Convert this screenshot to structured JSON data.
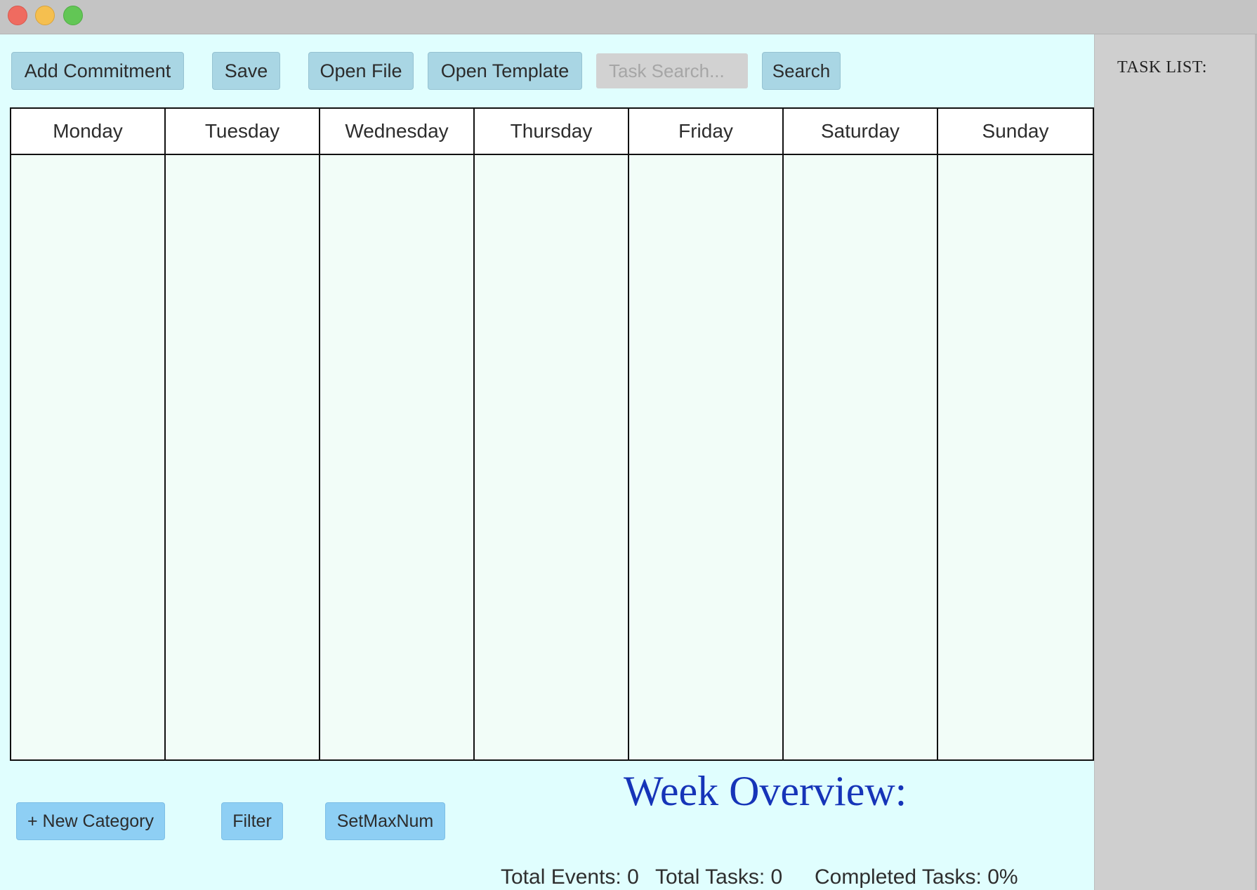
{
  "window": {
    "controls": [
      "close",
      "minimize",
      "maximize"
    ]
  },
  "toolbar": {
    "add_commitment": "Add Commitment",
    "save": "Save",
    "open_file": "Open File",
    "open_template": "Open Template",
    "search_placeholder": "Task Search...",
    "search_value": "",
    "search": "Search"
  },
  "calendar": {
    "days": [
      "Monday",
      "Tuesday",
      "Wednesday",
      "Thursday",
      "Friday",
      "Saturday",
      "Sunday"
    ]
  },
  "bottom": {
    "new_category": "+ New Category",
    "filter": "Filter",
    "set_max_num": "SetMaxNum"
  },
  "overview": {
    "title": "Week Overview:",
    "total_events": "Total Events: 0",
    "total_tasks": "Total Tasks: 0",
    "completed_tasks": "Completed Tasks: 0%"
  },
  "side_panel": {
    "title": "TASK LIST:"
  },
  "colors": {
    "main_bg": "#e0fefe",
    "toolbar_button": "#a9d6e4",
    "bottom_button": "#8ecff4",
    "overview_title": "#1634b8",
    "side_panel_bg": "#cfcfcf"
  }
}
